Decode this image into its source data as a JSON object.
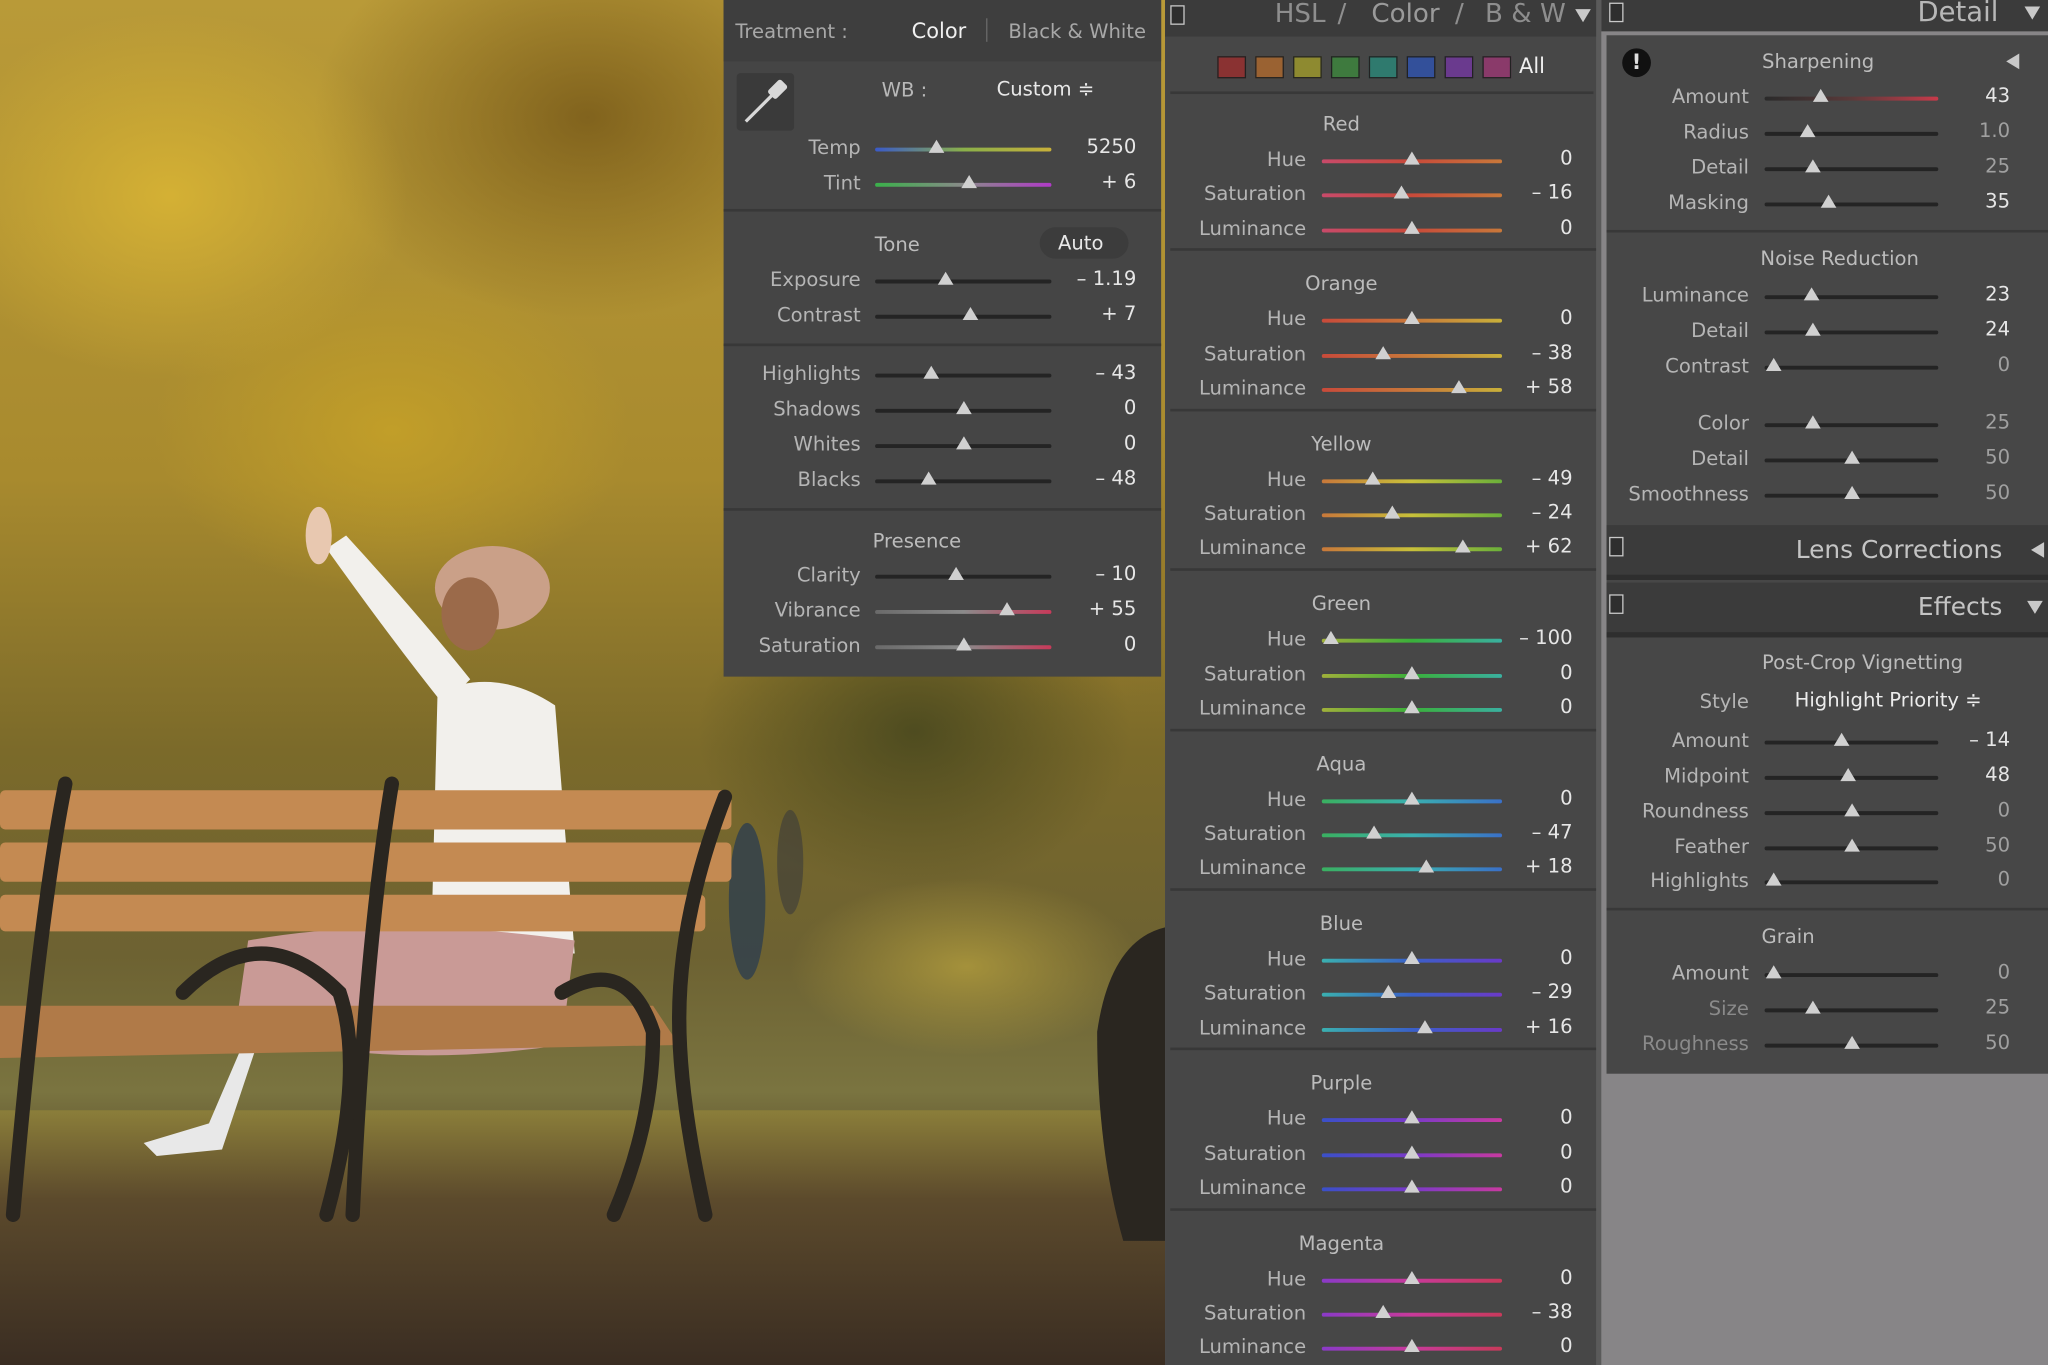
{
  "basic": {
    "treatment_label": "Treatment :",
    "treatment_color": "Color",
    "treatment_bw": "Black & White",
    "wb_label": "WB :",
    "wb_value": "Custom ≑",
    "temp": {
      "label": "Temp",
      "value": "5250",
      "level": 0.35
    },
    "tint": {
      "label": "Tint",
      "value": "+ 6",
      "level": 0.53
    },
    "tone_title": "Tone",
    "auto_label": "Auto",
    "tone": [
      {
        "label": "Exposure",
        "value": "– 1.19",
        "level": 0.4
      },
      {
        "label": "Contrast",
        "value": "+ 7",
        "level": 0.54
      }
    ],
    "tone2": [
      {
        "label": "Highlights",
        "value": "– 43",
        "level": 0.32
      },
      {
        "label": "Shadows",
        "value": "0",
        "level": 0.5
      },
      {
        "label": "Whites",
        "value": "0",
        "level": 0.5
      },
      {
        "label": "Blacks",
        "value": "– 48",
        "level": 0.3
      }
    ],
    "presence_title": "Presence",
    "presence": [
      {
        "label": "Clarity",
        "value": "– 10",
        "level": 0.46
      },
      {
        "label": "Vibrance",
        "value": "+ 55",
        "level": 0.75
      },
      {
        "label": "Saturation",
        "value": "0",
        "level": 0.5
      }
    ]
  },
  "hsl": {
    "tab_hsl": "HSL",
    "tab_color": "Color",
    "tab_bw": "B & W",
    "separator": "/",
    "all_label": "All",
    "swatch_colors": [
      "#8a3232",
      "#9a6232",
      "#8e8a30",
      "#3e7a3e",
      "#2f7a6e",
      "#33509a",
      "#6a3a8e",
      "#8a3a6a"
    ],
    "groups": [
      {
        "title": "Red",
        "gradient": [
          "#c84a6a",
          "#c84a3a",
          "#c8783a"
        ],
        "rows": [
          {
            "label": "Hue",
            "value": "0",
            "level": 0.5
          },
          {
            "label": "Saturation",
            "value": "– 16",
            "level": 0.44
          },
          {
            "label": "Luminance",
            "value": "0",
            "level": 0.5
          }
        ]
      },
      {
        "title": "Orange",
        "gradient": [
          "#c84a3a",
          "#c8783a",
          "#c8b03a"
        ],
        "rows": [
          {
            "label": "Hue",
            "value": "0",
            "level": 0.5
          },
          {
            "label": "Saturation",
            "value": "– 38",
            "level": 0.34
          },
          {
            "label": "Luminance",
            "value": "+ 58",
            "level": 0.76
          }
        ]
      },
      {
        "title": "Yellow",
        "gradient": [
          "#c8783a",
          "#c8c03a",
          "#6ab03a"
        ],
        "rows": [
          {
            "label": "Hue",
            "value": "– 49",
            "level": 0.28
          },
          {
            "label": "Saturation",
            "value": "– 24",
            "level": 0.39
          },
          {
            "label": "Luminance",
            "value": "+ 62",
            "level": 0.78
          }
        ]
      },
      {
        "title": "Green",
        "gradient": [
          "#a0b03a",
          "#3ab03a",
          "#3ab0a0"
        ],
        "rows": [
          {
            "label": "Hue",
            "value": "– 100",
            "level": 0.05
          },
          {
            "label": "Saturation",
            "value": "0",
            "level": 0.5
          },
          {
            "label": "Luminance",
            "value": "0",
            "level": 0.5
          }
        ]
      },
      {
        "title": "Aqua",
        "gradient": [
          "#3ab060",
          "#3ab0b0",
          "#3a70c8"
        ],
        "rows": [
          {
            "label": "Hue",
            "value": "0",
            "level": 0.5
          },
          {
            "label": "Saturation",
            "value": "– 47",
            "level": 0.29
          },
          {
            "label": "Luminance",
            "value": "+ 18",
            "level": 0.58
          }
        ]
      },
      {
        "title": "Blue",
        "gradient": [
          "#3ab0b0",
          "#3a60c8",
          "#6a3ac8"
        ],
        "rows": [
          {
            "label": "Hue",
            "value": "0",
            "level": 0.5
          },
          {
            "label": "Saturation",
            "value": "– 29",
            "level": 0.37
          },
          {
            "label": "Luminance",
            "value": "+ 16",
            "level": 0.57
          }
        ]
      },
      {
        "title": "Purple",
        "gradient": [
          "#3a50c8",
          "#7a3ac8",
          "#c83aa0"
        ],
        "rows": [
          {
            "label": "Hue",
            "value": "0",
            "level": 0.5
          },
          {
            "label": "Saturation",
            "value": "0",
            "level": 0.5
          },
          {
            "label": "Luminance",
            "value": "0",
            "level": 0.5
          }
        ]
      },
      {
        "title": "Magenta",
        "gradient": [
          "#8a3ac8",
          "#c83a9a",
          "#c83a5a"
        ],
        "rows": [
          {
            "label": "Hue",
            "value": "0",
            "level": 0.5
          },
          {
            "label": "Saturation",
            "value": "– 38",
            "level": 0.34
          },
          {
            "label": "Luminance",
            "value": "0",
            "level": 0.5
          }
        ]
      }
    ]
  },
  "detail": {
    "title": "Detail",
    "sharpening_title": "Sharpening",
    "sharpening": [
      {
        "label": "Amount",
        "value": "43",
        "level": 0.32,
        "hl": true,
        "red": true
      },
      {
        "label": "Radius",
        "value": "1.0",
        "level": 0.25,
        "hl": false
      },
      {
        "label": "Detail",
        "value": "25",
        "level": 0.28,
        "hl": false
      },
      {
        "label": "Masking",
        "value": "35",
        "level": 0.37,
        "hl": true
      }
    ],
    "noise_title": "Noise Reduction",
    "noise": [
      {
        "label": "Luminance",
        "value": "23",
        "level": 0.27,
        "hl": true
      },
      {
        "label": "Detail",
        "value": "24",
        "level": 0.28,
        "hl": true
      },
      {
        "label": "Contrast",
        "value": "0",
        "level": 0.05,
        "hl": false
      }
    ],
    "noise_color": [
      {
        "label": "Color",
        "value": "25",
        "level": 0.28,
        "hl": false
      },
      {
        "label": "Detail",
        "value": "50",
        "level": 0.5,
        "hl": false
      },
      {
        "label": "Smoothness",
        "value": "50",
        "level": 0.5,
        "hl": false
      }
    ]
  },
  "lens": {
    "title": "Lens Corrections"
  },
  "effects": {
    "title": "Effects",
    "vignette_title": "Post-Crop Vignetting",
    "style_label": "Style",
    "style_value": "Highlight Priority ≑",
    "vignette": [
      {
        "label": "Amount",
        "value": "– 14",
        "level": 0.44,
        "hl": true
      },
      {
        "label": "Midpoint",
        "value": "48",
        "level": 0.48,
        "hl": true
      },
      {
        "label": "Roundness",
        "value": "0",
        "level": 0.5,
        "hl": false
      },
      {
        "label": "Feather",
        "value": "50",
        "level": 0.5,
        "hl": false
      },
      {
        "label": "Highlights",
        "value": "0",
        "level": 0.05,
        "hl": false
      }
    ],
    "grain_title": "Grain",
    "grain": [
      {
        "label": "Amount",
        "value": "0",
        "level": 0.05,
        "hl": false
      },
      {
        "label": "Size",
        "value": "25",
        "level": 0.28,
        "hl": false,
        "faint": true
      },
      {
        "label": "Roughness",
        "value": "50",
        "level": 0.5,
        "hl": false,
        "faint": true
      }
    ]
  }
}
